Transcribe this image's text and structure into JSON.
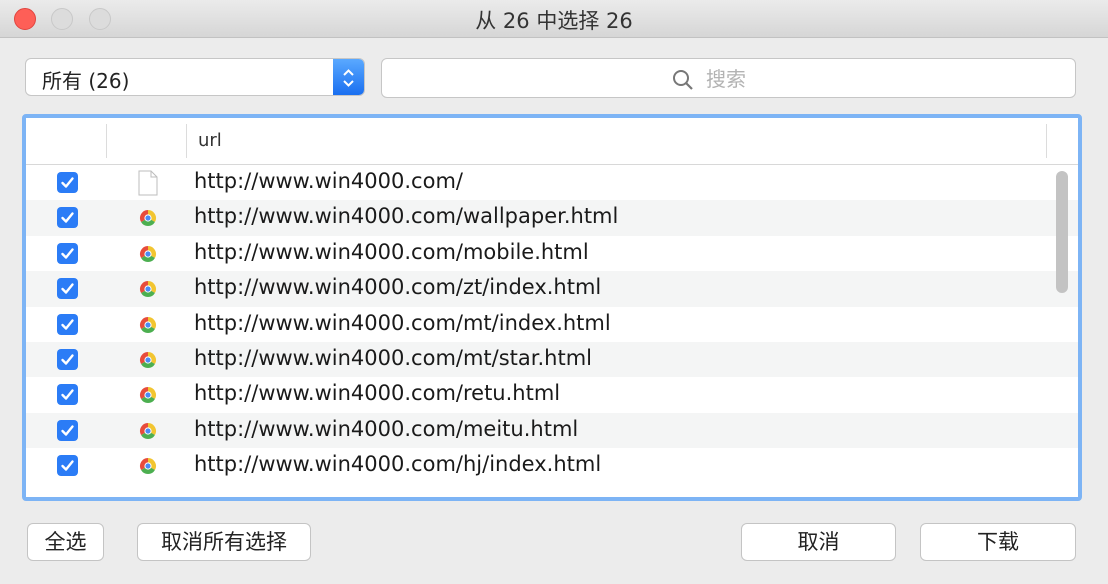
{
  "window": {
    "title": "从 26 中选择 26"
  },
  "filter": {
    "selected": "所有 (26)"
  },
  "search": {
    "placeholder": "搜索",
    "value": ""
  },
  "table": {
    "columns": [
      "",
      "",
      "url"
    ],
    "rows": [
      {
        "checked": true,
        "icon": "blank-document-icon",
        "url": "http://www.win4000.com/"
      },
      {
        "checked": true,
        "icon": "chrome-icon",
        "url": "http://www.win4000.com/wallpaper.html"
      },
      {
        "checked": true,
        "icon": "chrome-icon",
        "url": "http://www.win4000.com/mobile.html"
      },
      {
        "checked": true,
        "icon": "chrome-icon",
        "url": "http://www.win4000.com/zt/index.html"
      },
      {
        "checked": true,
        "icon": "chrome-icon",
        "url": "http://www.win4000.com/mt/index.html"
      },
      {
        "checked": true,
        "icon": "chrome-icon",
        "url": "http://www.win4000.com/mt/star.html"
      },
      {
        "checked": true,
        "icon": "chrome-icon",
        "url": "http://www.win4000.com/retu.html"
      },
      {
        "checked": true,
        "icon": "chrome-icon",
        "url": "http://www.win4000.com/meitu.html"
      },
      {
        "checked": true,
        "icon": "chrome-icon",
        "url": "http://www.win4000.com/hj/index.html"
      }
    ]
  },
  "buttons": {
    "select_all": "全选",
    "deselect_all": "取消所有选择",
    "cancel": "取消",
    "download": "下载"
  },
  "colors": {
    "accent": "#2b7cf6",
    "focus_ring": "#7db4f5",
    "close": "#fe5f57"
  }
}
